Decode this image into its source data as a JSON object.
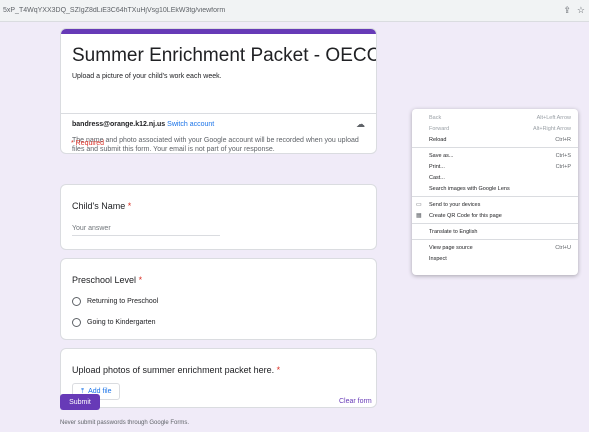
{
  "browser": {
    "url": "5xP_T4WqYXX3DQ_SZIgZ8dLiE3C64hTXuHjVsg10LEkW3tg/viewform",
    "share_icon": "share-icon",
    "bookmark_icon": "star-icon"
  },
  "form": {
    "title": "Summer Enrichment Packet - OECC",
    "description": "Upload a picture of your child's work each week.",
    "account_email": "bandress@orange.k12.nj.us",
    "switch_account": "Switch account",
    "notice": "The name and photo associated with your Google account will be recorded when you upload files and submit this form. Your email is not part of your response.",
    "required_note": "* Required",
    "questions": {
      "child_name": {
        "label": "Child's Name",
        "star": "*",
        "placeholder": "Your answer"
      },
      "preschool_level": {
        "label": "Preschool Level",
        "star": "*",
        "options": [
          "Returning to Preschool",
          "Going to Kindergarten"
        ]
      },
      "upload": {
        "label": "Upload photos of summer enrichment packet here.",
        "star": "*",
        "button": "Add file"
      }
    },
    "submit": "Submit",
    "clear": "Clear form",
    "footer": "Never submit passwords through Google Forms."
  },
  "context_menu": {
    "items": [
      {
        "label": "Back",
        "shortcut": "Alt+Left Arrow",
        "disabled": true
      },
      {
        "label": "Forward",
        "shortcut": "Alt+Right Arrow",
        "disabled": true
      },
      {
        "label": "Reload",
        "shortcut": "Ctrl+R",
        "disabled": false
      },
      {
        "label": "Save as...",
        "shortcut": "Ctrl+S",
        "disabled": false
      },
      {
        "label": "Print...",
        "shortcut": "Ctrl+P",
        "disabled": false
      },
      {
        "label": "Cast...",
        "shortcut": "",
        "disabled": false
      },
      {
        "label": "Search images with Google Lens",
        "shortcut": "",
        "disabled": false
      },
      {
        "label": "Send to your devices",
        "shortcut": "",
        "disabled": false
      },
      {
        "label": "Create QR Code for this page",
        "shortcut": "",
        "disabled": false
      },
      {
        "label": "Translate to English",
        "shortcut": "",
        "disabled": false
      },
      {
        "label": "View page source",
        "shortcut": "Ctrl+U",
        "disabled": false
      },
      {
        "label": "Inspect",
        "shortcut": "",
        "disabled": false
      }
    ]
  },
  "colors": {
    "accent": "#673ab7",
    "background": "#f0ebf8",
    "link": "#1a73e8",
    "required": "#d93025"
  }
}
